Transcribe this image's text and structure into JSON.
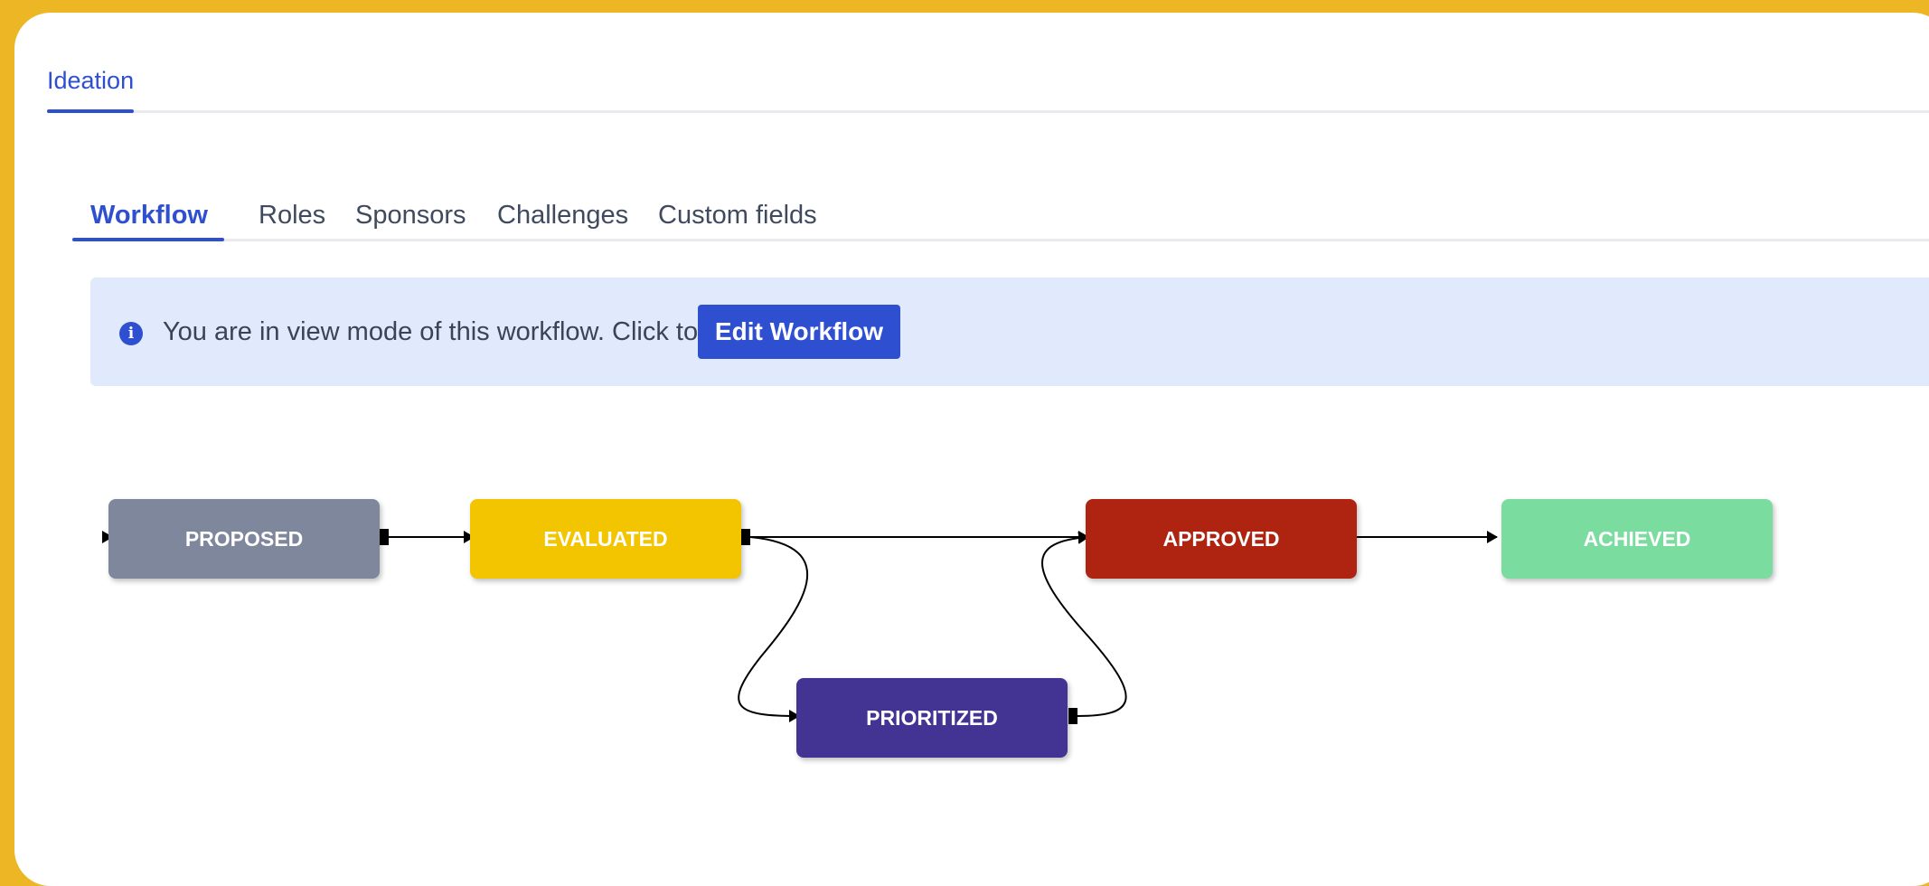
{
  "top_tabs": [
    {
      "label": "Ideation"
    }
  ],
  "sub_tabs": [
    {
      "label": "Workflow"
    },
    {
      "label": "Roles"
    },
    {
      "label": "Sponsors"
    },
    {
      "label": "Challenges"
    },
    {
      "label": "Custom fields"
    }
  ],
  "banner": {
    "message": "You are in view mode of this workflow. Click to",
    "button_label": "Edit Workflow",
    "icon": "info-icon"
  },
  "workflow": {
    "nodes": [
      {
        "id": "proposed",
        "label": "PROPOSED",
        "color": "#7F879C"
      },
      {
        "id": "evaluated",
        "label": "EVALUATED",
        "color": "#F2C500"
      },
      {
        "id": "approved",
        "label": "APPROVED",
        "color": "#AE2410"
      },
      {
        "id": "achieved",
        "label": "ACHIEVED",
        "color": "#7BDCA0"
      },
      {
        "id": "prioritized",
        "label": "PRIORITIZED",
        "color": "#433393"
      }
    ],
    "edges": [
      {
        "from": "proposed",
        "to": "evaluated"
      },
      {
        "from": "evaluated",
        "to": "approved"
      },
      {
        "from": "evaluated",
        "to": "prioritized"
      },
      {
        "from": "prioritized",
        "to": "approved"
      },
      {
        "from": "approved",
        "to": "achieved"
      }
    ]
  },
  "colors": {
    "accent": "#2F4FD1",
    "banner_bg": "#E0EAFC",
    "frame": "#EDB625"
  }
}
